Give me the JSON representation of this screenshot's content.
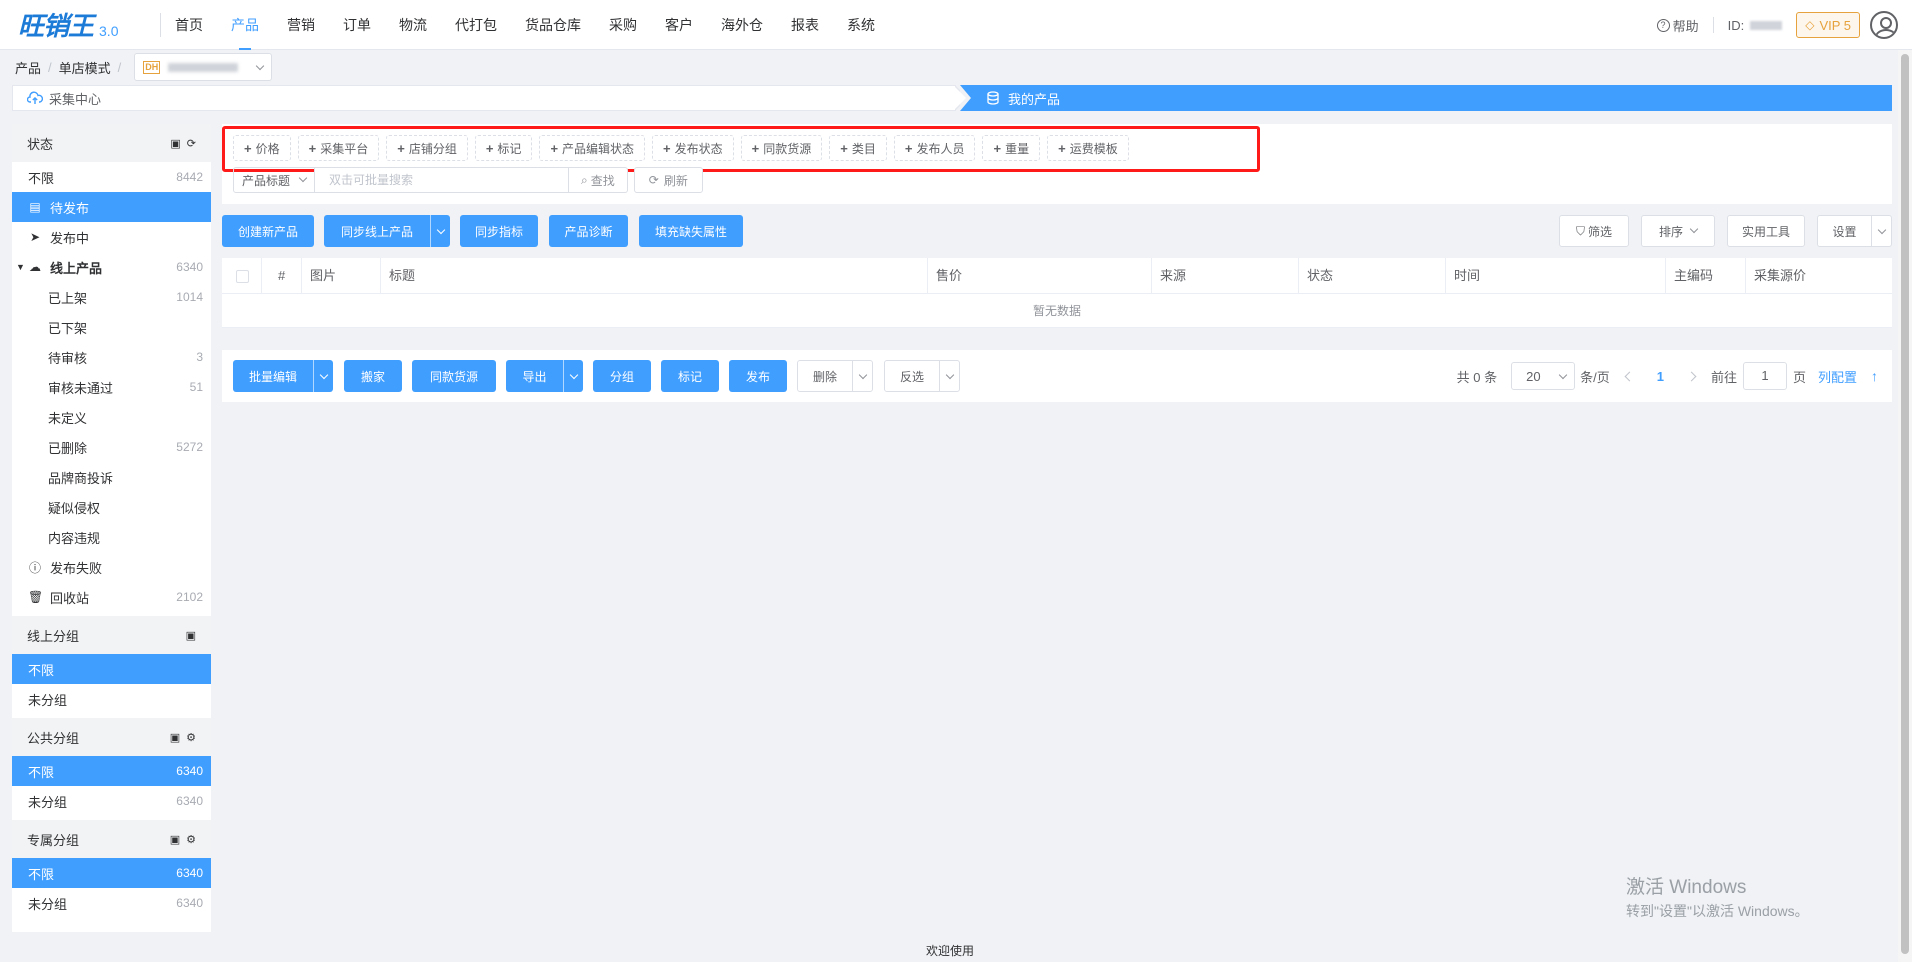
{
  "app": {
    "logo": "旺销王",
    "version": "3.0"
  },
  "nav": {
    "items": [
      "首页",
      "产品",
      "营销",
      "订单",
      "物流",
      "代打包",
      "货品仓库",
      "采购",
      "客户",
      "海外仓",
      "报表",
      "系统"
    ],
    "active": "产品"
  },
  "topright": {
    "help": "帮助",
    "id_label": "ID:",
    "vip": "VIP 5"
  },
  "breadcrumb": {
    "items": [
      "产品",
      "单店模式"
    ],
    "shop_badge": "DH"
  },
  "tabs": {
    "tab1": "采集中心",
    "tab2": "我的产品"
  },
  "sidebar": {
    "status_title": "状态",
    "status_items": [
      {
        "label": "不限",
        "count": "8442"
      },
      {
        "label": "待发布",
        "count": ""
      },
      {
        "label": "发布中",
        "count": ""
      },
      {
        "label": "线上产品",
        "count": "6340"
      },
      {
        "label": "已上架",
        "count": "1014"
      },
      {
        "label": "已下架",
        "count": ""
      },
      {
        "label": "待审核",
        "count": "3"
      },
      {
        "label": "审核未通过",
        "count": "51"
      },
      {
        "label": "未定义",
        "count": ""
      },
      {
        "label": "已删除",
        "count": "5272"
      },
      {
        "label": "品牌商投诉",
        "count": ""
      },
      {
        "label": "疑似侵权",
        "count": ""
      },
      {
        "label": "内容违规",
        "count": ""
      },
      {
        "label": "发布失败",
        "count": ""
      },
      {
        "label": "回收站",
        "count": "2102"
      }
    ],
    "online_group_title": "线上分组",
    "online_group_items": [
      {
        "label": "不限",
        "count": ""
      },
      {
        "label": "未分组",
        "count": ""
      }
    ],
    "public_group_title": "公共分组",
    "public_group_items": [
      {
        "label": "不限",
        "count": "6340"
      },
      {
        "label": "未分组",
        "count": "6340"
      }
    ],
    "private_group_title": "专属分组",
    "private_group_items": [
      {
        "label": "不限",
        "count": "6340"
      },
      {
        "label": "未分组",
        "count": "6340"
      }
    ]
  },
  "filters": {
    "chips": [
      "价格",
      "采集平台",
      "店铺分组",
      "标记",
      "产品编辑状态",
      "发布状态",
      "同款货源",
      "类目",
      "发布人员",
      "重量",
      "运费模板"
    ],
    "search_field": "产品标题",
    "search_placeholder": "双击可批量搜索",
    "search_button": "查找",
    "refresh_button": "刷新"
  },
  "toolbar": {
    "create": "创建新产品",
    "sync_online": "同步线上产品",
    "sync_metrics": "同步指标",
    "diagnose": "产品诊断",
    "fill_attrs": "填充缺失属性",
    "filter": "筛选",
    "sort": "排序",
    "tools": "实用工具",
    "settings": "设置"
  },
  "table": {
    "columns": [
      "#",
      "图片",
      "标题",
      "售价",
      "来源",
      "状态",
      "时间",
      "主编码",
      "采集源价"
    ],
    "empty_text": "暂无数据"
  },
  "bottom": {
    "batch_edit": "批量编辑",
    "move": "搬家",
    "same_source": "同款货源",
    "export": "导出",
    "group": "分组",
    "mark": "标记",
    "publish": "发布",
    "delete": "删除",
    "invert": "反选"
  },
  "pagination": {
    "total": "共 0 条",
    "page_size": "20",
    "per_page": "条/页",
    "current": "1",
    "goto": "前往",
    "goto_value": "1",
    "page": "页",
    "col_config": "列配置",
    "top_icon": "↑"
  },
  "footer": "欢迎使用",
  "watermark": {
    "line1": "激活 Windows",
    "line2": "转到\"设置\"以激活 Windows。"
  }
}
